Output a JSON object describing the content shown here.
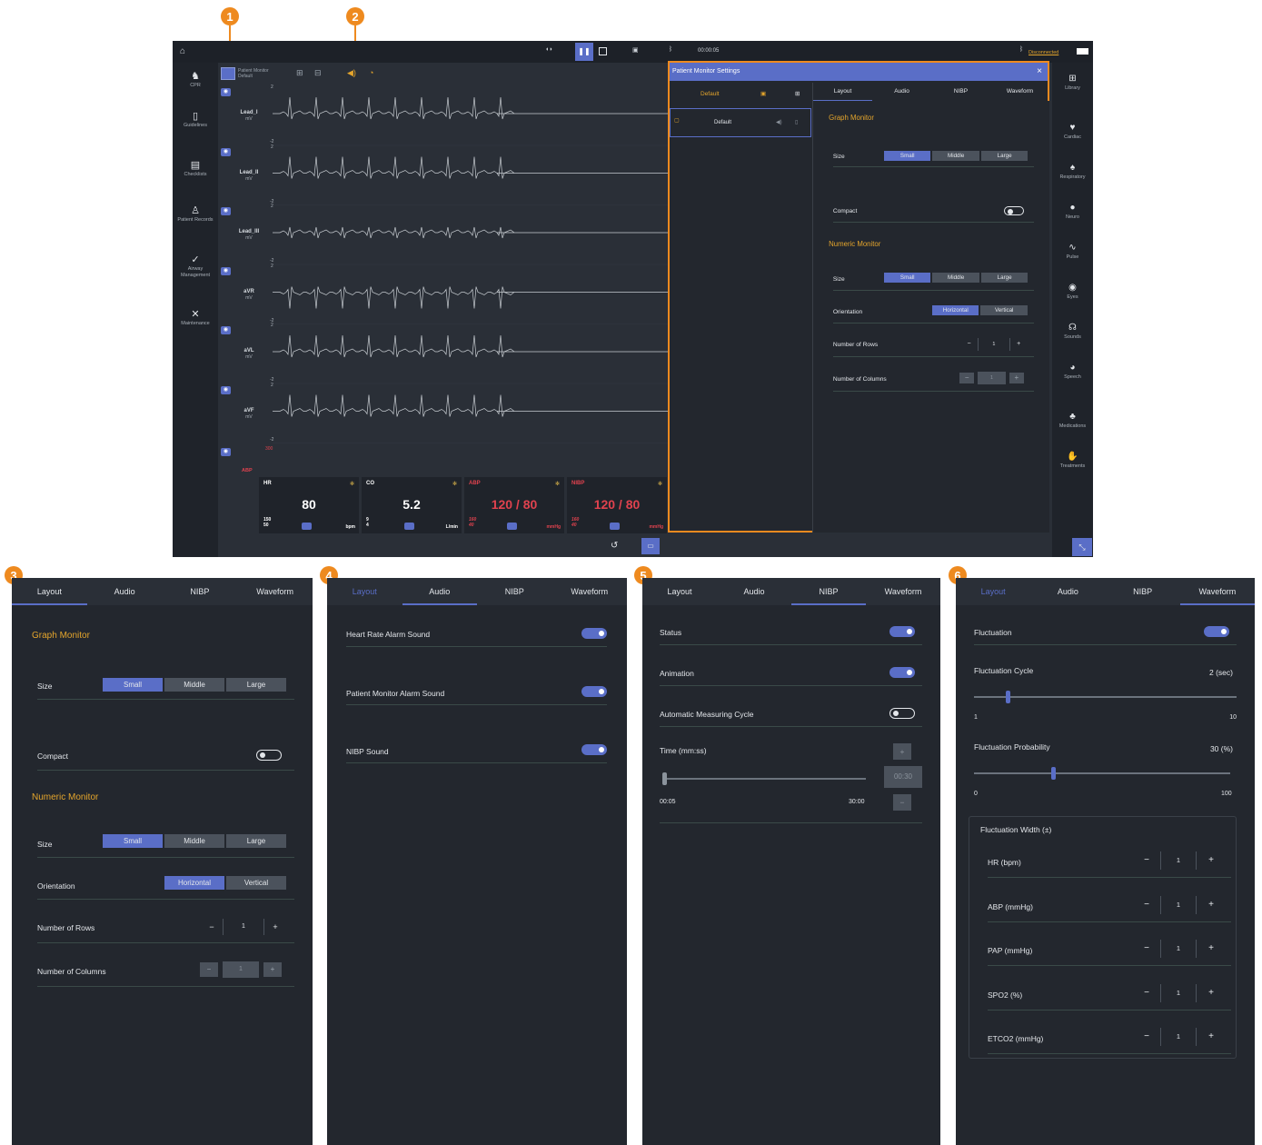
{
  "badges": [
    "1",
    "2",
    "3",
    "4",
    "5",
    "6"
  ],
  "topbar": {
    "timer": "00:00:05",
    "bt_status": "Disconnected"
  },
  "leftnav": [
    {
      "label": "CPR",
      "icon": "cpr-icon"
    },
    {
      "label": "Guidelines",
      "icon": "book-icon"
    },
    {
      "label": "Checklists",
      "icon": "clipboard-icon"
    },
    {
      "label": "Patient Records",
      "icon": "patient-icon"
    },
    {
      "label": "Airway Management",
      "icon": "airway-icon"
    },
    {
      "label": "Maintenance",
      "icon": "tools-icon"
    }
  ],
  "rightnav": [
    {
      "label": "Library"
    },
    {
      "label": "Cardiac"
    },
    {
      "label": "Respiratory"
    },
    {
      "label": "Neuro"
    },
    {
      "label": "Pulse"
    },
    {
      "label": "Eyes"
    },
    {
      "label": "Sounds"
    },
    {
      "label": "Speech"
    },
    {
      "label": "Medications"
    },
    {
      "label": "Treatments"
    }
  ],
  "wavetool": {
    "title": "Patient Monitor",
    "subtitle": "Default"
  },
  "waves": [
    {
      "name": "Lead_I",
      "unit": "mV",
      "top": "2",
      "bot": "-2"
    },
    {
      "name": "Lead_II",
      "unit": "mV",
      "top": "2",
      "bot": "-2"
    },
    {
      "name": "Lead_III",
      "unit": "mV",
      "top": "2",
      "bot": "-2"
    },
    {
      "name": "aVR",
      "unit": "mV",
      "top": "2",
      "bot": "-2"
    },
    {
      "name": "aVL",
      "unit": "mV",
      "top": "2",
      "bot": "-2"
    },
    {
      "name": "aVF",
      "unit": "mV",
      "top": "2",
      "bot": "-2"
    }
  ],
  "abp_wave": {
    "name": "ABP",
    "top": "300"
  },
  "numerics": [
    {
      "label": "HR",
      "value": "80",
      "hi": "150",
      "lo": "50",
      "unit": "bpm",
      "color": "#ffffff"
    },
    {
      "label": "CO",
      "value": "5.2",
      "hi": "9",
      "lo": "4",
      "unit": "L/min",
      "color": "#ffffff"
    },
    {
      "label": "ABP",
      "value": "120 / 80",
      "hi": "160",
      "lo": "40",
      "unit": "mmHg",
      "color": "#e0424e"
    },
    {
      "label": "NIBP",
      "value": "120 / 80",
      "hi": "160",
      "lo": "40",
      "unit": "mmHg",
      "color": "#e0424e"
    }
  ],
  "settings": {
    "title": "Patient Monitor Settings",
    "close": "×",
    "preset_header": "Default",
    "preset_item": "Default",
    "tabs": [
      "Layout",
      "Audio",
      "NIBP",
      "Waveform"
    ],
    "graph_monitor": "Graph Monitor",
    "size": "Size",
    "sizes": [
      "Small",
      "Middle",
      "Large"
    ],
    "compact": "Compact",
    "numeric_monitor": "Numeric Monitor",
    "orientation": "Orientation",
    "orientations": [
      "Horizontal",
      "Vertical"
    ],
    "rows": "Number of Rows",
    "cols": "Number of Columns",
    "rows_val": "1",
    "cols_val": "1",
    "minus": "−",
    "plus": "+"
  },
  "audio": {
    "items": [
      "Heart Rate Alarm Sound",
      "Patient Monitor Alarm Sound",
      "NIBP Sound"
    ]
  },
  "nibp": {
    "status": "Status",
    "animation": "Animation",
    "auto": "Automatic Measuring Cycle",
    "time": "Time (mm:ss)",
    "time_val": "00:30",
    "min": "00:05",
    "max": "30:00"
  },
  "waveform": {
    "fluctuation": "Fluctuation",
    "cycle": "Fluctuation Cycle",
    "cycle_val": "2 (sec)",
    "cycle_min": "1",
    "cycle_max": "10",
    "cycle_level": 0.12,
    "prob": "Fluctuation Probability",
    "prob_val": "30 (%)",
    "prob_min": "0",
    "prob_max": "100",
    "prob_level": 0.3,
    "width": "Fluctuation Width (±)",
    "items": [
      "HR (bpm)",
      "ABP (mmHg)",
      "PAP (mmHg)",
      "SPO2 (%)",
      "ETCO2 (mmHg)"
    ],
    "val": "1"
  }
}
